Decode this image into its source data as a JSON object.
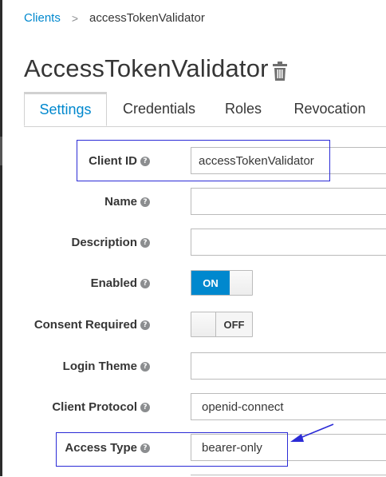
{
  "breadcrumb": {
    "parent": "Clients",
    "separator": ">",
    "current": "accessTokenValidator"
  },
  "page": {
    "title": "AccessTokenValidator"
  },
  "tabs": [
    {
      "label": "Settings",
      "active": true
    },
    {
      "label": "Credentials",
      "active": false
    },
    {
      "label": "Roles",
      "active": false
    },
    {
      "label": "Revocation",
      "active": false
    }
  ],
  "form": {
    "client_id": {
      "label": "Client ID",
      "value": "accessTokenValidator"
    },
    "name": {
      "label": "Name",
      "value": ""
    },
    "description": {
      "label": "Description",
      "value": ""
    },
    "enabled": {
      "label": "Enabled",
      "state": "ON"
    },
    "consent_required": {
      "label": "Consent Required",
      "state": "OFF"
    },
    "login_theme": {
      "label": "Login Theme",
      "value": ""
    },
    "client_protocol": {
      "label": "Client Protocol",
      "value": "openid-connect"
    },
    "access_type": {
      "label": "Access Type",
      "value": "bearer-only"
    }
  },
  "help_glyph": "?",
  "colors": {
    "accent": "#0088ce",
    "annotation": "#2b2bd6",
    "text": "#363636",
    "border": "#bbbbbb"
  },
  "icons": {
    "trash": "trash-icon",
    "help": "help-icon",
    "separator": "chevron-right-icon"
  }
}
